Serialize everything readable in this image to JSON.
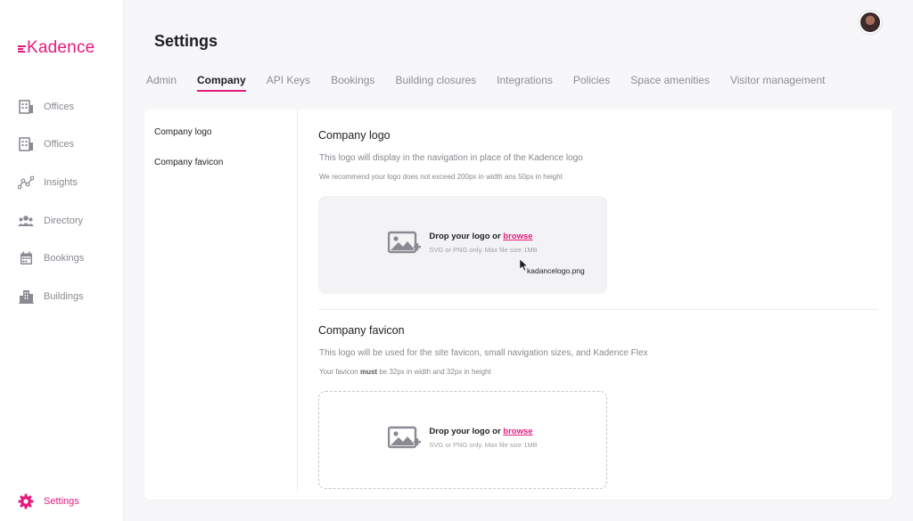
{
  "brand": {
    "name": "Kadence",
    "accent": "#e6197d"
  },
  "sidebar": {
    "items": [
      {
        "label": "Offices",
        "icon": "offices-icon"
      },
      {
        "label": "Offices",
        "icon": "offices-icon"
      },
      {
        "label": "Insights",
        "icon": "insights-icon"
      },
      {
        "label": "Directory",
        "icon": "directory-icon"
      },
      {
        "label": "Bookings",
        "icon": "calendar-icon"
      },
      {
        "label": "Buildings",
        "icon": "buildings-icon"
      }
    ],
    "settings_label": "Settings"
  },
  "header": {
    "title": "Settings",
    "tabs": [
      {
        "label": "Admin"
      },
      {
        "label": "Company",
        "active": true
      },
      {
        "label": "API Keys"
      },
      {
        "label": "Bookings"
      },
      {
        "label": "Building closures"
      },
      {
        "label": "Integrations"
      },
      {
        "label": "Policies"
      },
      {
        "label": "Space amenities"
      },
      {
        "label": "Visitor management"
      }
    ]
  },
  "subnav": [
    "Company logo",
    "Company favicon"
  ],
  "logo_section": {
    "title": "Company logo",
    "description": "This logo will display in the navigation in place of the Kadence logo",
    "note": "We recommend your logo does not exceed 200px in width ans 50px in height",
    "drop_prefix": "Drop your logo or ",
    "drop_link": "browse",
    "hint": "SVG or PNG only. Max file size 1MB",
    "dragged_file": "kadancelogo.png"
  },
  "favicon_section": {
    "title": "Company favicon",
    "description": "This logo will be used for the site favicon, small navigation sizes, and Kadence Flex",
    "note_prefix": "Your favicon ",
    "note_bold": "must",
    "note_suffix": " be 32px in width and 32px in height",
    "drop_prefix": "Drop your logo or ",
    "drop_link": "browse",
    "hint": "SVG or PNG only. Max file size 1MB"
  }
}
